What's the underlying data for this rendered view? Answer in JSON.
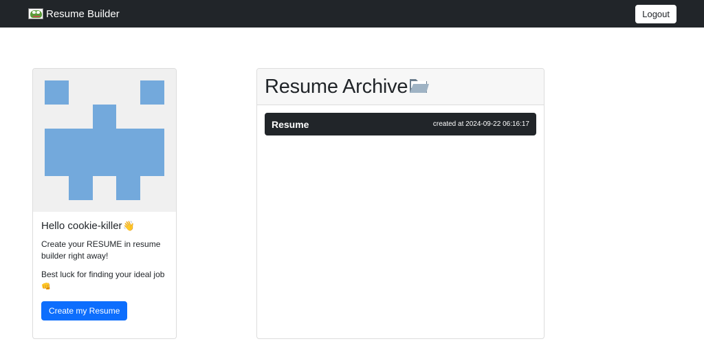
{
  "navbar": {
    "brand": "Resume Builder",
    "logout_label": "Logout"
  },
  "profile": {
    "greeting": "Hello cookie-killer",
    "wave_emoji": "👋",
    "line1": "Create your RESUME in resume builder right away!",
    "line2": "Best luck for finding your ideal job",
    "fist_emoji": "👊",
    "create_label": "Create my Resume",
    "avatar_color": "#73a9dc"
  },
  "archive": {
    "title": "Resume Archive",
    "items": [
      {
        "name": "Resume",
        "created": "created at 2024-09-22 06:16:17"
      }
    ]
  },
  "colors": {
    "navbar_bg": "#212529",
    "primary": "#0d6efd",
    "item_bg": "#212529"
  }
}
